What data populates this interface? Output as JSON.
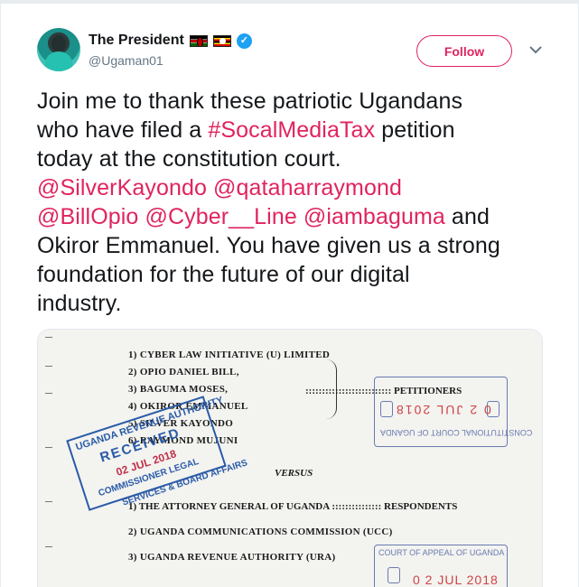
{
  "tweet": {
    "author": {
      "display_name": "The President",
      "handle": "@Ugaman01",
      "flags": [
        "kenya-flag",
        "uganda-flag"
      ],
      "verified": true
    },
    "follow_button": "Follow",
    "text_lines": [
      [
        {
          "t": "Join me to thank these patriotic Ugandans",
          "link": false
        }
      ],
      [
        {
          "t": "who have filed a ",
          "link": false
        },
        {
          "t": "#SocalMediaTax",
          "link": true
        },
        {
          "t": " petition",
          "link": false
        }
      ],
      [
        {
          "t": "today at the constitution court.",
          "link": false
        }
      ],
      [
        {
          "t": "@SilverKayondo",
          "link": true
        },
        {
          "t": " ",
          "link": false
        },
        {
          "t": "@qataharraymond",
          "link": true
        }
      ],
      [
        {
          "t": "@BillOpio",
          "link": true
        },
        {
          "t": " ",
          "link": false
        },
        {
          "t": "@Cyber__Line",
          "link": true
        },
        {
          "t": " ",
          "link": false
        },
        {
          "t": "@iambaguma",
          "link": true
        },
        {
          "t": " and",
          "link": false
        }
      ],
      [
        {
          "t": "Okiror Emmanuel. You have given us a strong",
          "link": false
        }
      ],
      [
        {
          "t": "foundation for the future of our digital",
          "link": false
        }
      ],
      [
        {
          "t": "industry.",
          "link": false
        }
      ]
    ]
  },
  "document": {
    "petitioners": [
      "1) CYBER LAW INITIATIVE (U) LIMITED",
      "2) OPIO DANIEL BILL,",
      "3) BAGUMA MOSES,",
      "4) OKIROR EMMANUEL",
      "5) SILVER KAYONDO",
      "6) RAYMOND MUJUNI"
    ],
    "petitioners_label": ":::::::::::::::::::::::::: PETITIONERS",
    "versus": "VERSUS",
    "respondent_1": "1) THE ATTORNEY GENERAL OF UGANDA ::::::::::::::: RESPONDENTS",
    "respondent_2": "2) UGANDA COMMUNICATIONS COMMISSION (UCC)",
    "respondent_3": "3) UGANDA REVENUE AUTHORITY (URA)",
    "stamp_received": {
      "line1": "UGANDA REVENUE AUTHORITY",
      "line2": "RECEIVED",
      "line3": "02 JUL 2018",
      "line4": "COMMISSIONER LEGAL",
      "line5": "SERVICES & BOARD AFFAIRS"
    },
    "stamp_court_top": {
      "date": "0 2 JUL 2018",
      "text": "CONSTITUTIONAL COURT OF UGANDA"
    },
    "stamp_court_bottom": {
      "title": "COURT OF APPEAL OF UGANDA",
      "date": "0 2 JUL 2018"
    }
  },
  "colors": {
    "link": "#e0245e",
    "verified": "#1da1f2",
    "text": "#14171a",
    "muted": "#657786"
  }
}
